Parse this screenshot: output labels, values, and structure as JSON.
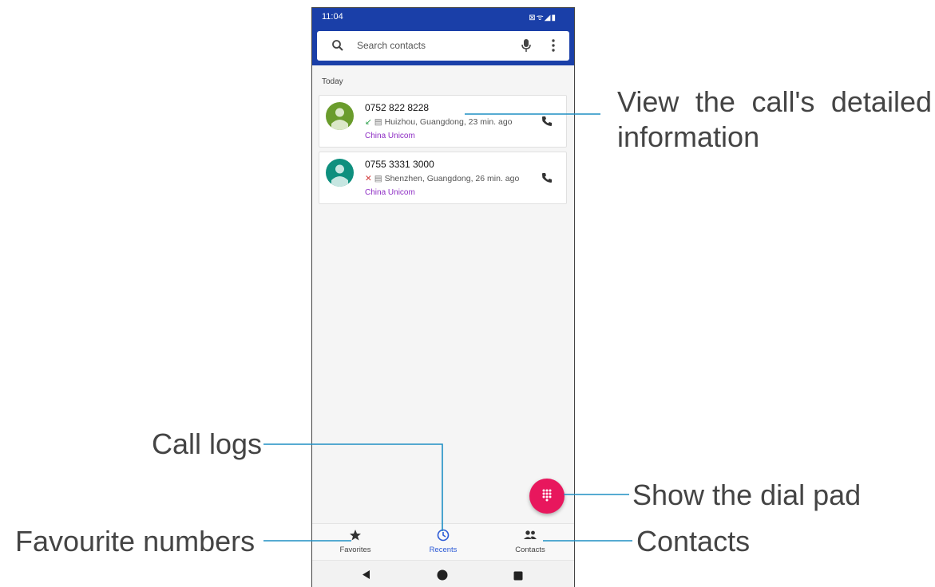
{
  "status_bar": {
    "time": "11:04",
    "icons_text": "⊠ᯤ◢▮"
  },
  "search": {
    "placeholder": "Search contacts"
  },
  "section_label": "Today",
  "calls": [
    {
      "number": "0752 822 8228",
      "location": "Huizhou, Guangdong, 23 min. ago",
      "carrier": "China Unicom",
      "call_type": "incoming",
      "avatar_color": "#6a9c2c"
    },
    {
      "number": "0755 3331 3000",
      "location": "Shenzhen, Guangdong, 26 min. ago",
      "carrier": "China Unicom",
      "call_type": "missed",
      "avatar_color": "#0e8f7e"
    }
  ],
  "bottom_nav": {
    "items": [
      {
        "label": "Favorites",
        "icon": "star-icon"
      },
      {
        "label": "Recents",
        "icon": "clock-icon",
        "active": true
      },
      {
        "label": "Contacts",
        "icon": "people-icon"
      }
    ]
  },
  "callouts": {
    "detail_line1": "View the call's detailed",
    "detail_line2": "information",
    "call_logs": "Call logs",
    "dial_pad": "Show the dial pad",
    "favourites": "Favourite numbers",
    "contacts": "Contacts"
  },
  "colors": {
    "app_bar": "#1a3fa8",
    "accent": "#2d5bd6",
    "fab": "#e8175d",
    "carrier_text": "#8e2ec4",
    "callout_line": "#1f8fc4"
  }
}
